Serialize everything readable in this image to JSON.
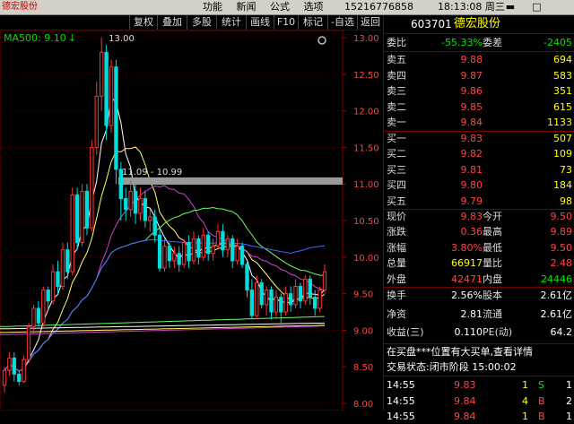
{
  "app": {
    "title": "德宏股份",
    "menu": [
      "功能",
      "新闻",
      "公式",
      "选项"
    ],
    "phone": "15216776858",
    "clock": "18:13:08 周三",
    "window_buttons": [
      "▬",
      "□",
      "✕"
    ]
  },
  "toolbar": [
    "复权",
    "叠加",
    "多股",
    "统计",
    "画线",
    "F10",
    "标记",
    "-自选",
    "返回"
  ],
  "chart_data": {
    "type": "candlestick",
    "indicator_label": "MA500: 9.10",
    "indicator_arrow": "↓",
    "y_ticks": [
      "13.00",
      "12.50",
      "12.00",
      "11.50",
      "11.00",
      "10.50",
      "10.00",
      "9.50",
      "9.00",
      "8.50",
      "8.00"
    ],
    "ylim": [
      8.0,
      13.05
    ],
    "high_label": "13.00",
    "band_label": "11.09 - 10.99",
    "band": [
      10.99,
      11.09
    ],
    "candles": [
      [
        8.25,
        8.45,
        8.15,
        8.5
      ],
      [
        8.45,
        8.62,
        8.38,
        8.7
      ],
      [
        8.62,
        8.4,
        8.3,
        8.7
      ],
      [
        8.4,
        8.3,
        8.25,
        8.45
      ],
      [
        8.3,
        8.6,
        8.28,
        8.65
      ],
      [
        8.6,
        9.05,
        8.55,
        9.1
      ],
      [
        9.05,
        9.3,
        8.95,
        9.35
      ],
      [
        9.3,
        9.1,
        9.05,
        9.4
      ],
      [
        9.1,
        9.55,
        9.05,
        9.6
      ],
      [
        9.55,
        9.4,
        9.3,
        9.6
      ],
      [
        9.4,
        9.8,
        9.35,
        9.9
      ],
      [
        9.8,
        9.6,
        9.5,
        9.95
      ],
      [
        9.6,
        10.1,
        9.55,
        10.2
      ],
      [
        10.1,
        9.8,
        9.7,
        10.2
      ],
      [
        9.8,
        10.85,
        9.75,
        10.95
      ],
      [
        10.85,
        10.2,
        10.1,
        10.95
      ],
      [
        10.2,
        10.9,
        10.15,
        11.0
      ],
      [
        10.9,
        10.4,
        10.3,
        11.0
      ],
      [
        10.4,
        11.5,
        10.35,
        11.6
      ],
      [
        11.5,
        12.2,
        11.4,
        12.4
      ],
      [
        12.2,
        12.8,
        12.0,
        13.0
      ],
      [
        12.8,
        11.8,
        11.6,
        12.9
      ],
      [
        11.8,
        12.6,
        11.7,
        12.7
      ],
      [
        12.6,
        11.2,
        11.0,
        12.7
      ],
      [
        11.2,
        10.8,
        10.5,
        11.3
      ],
      [
        10.8,
        10.65,
        10.5,
        10.95
      ],
      [
        10.65,
        10.9,
        10.55,
        11.05
      ],
      [
        10.9,
        10.6,
        10.45,
        11.0
      ],
      [
        10.6,
        10.8,
        10.5,
        10.95
      ],
      [
        10.8,
        10.5,
        10.4,
        10.9
      ],
      [
        10.5,
        10.55,
        10.35,
        10.65
      ],
      [
        10.55,
        10.3,
        10.2,
        10.65
      ],
      [
        10.3,
        9.85,
        9.8,
        10.4
      ],
      [
        9.85,
        10.15,
        9.8,
        10.25
      ],
      [
        10.15,
        9.95,
        9.85,
        10.2
      ],
      [
        9.95,
        10.05,
        9.85,
        10.15
      ],
      [
        10.05,
        9.9,
        9.8,
        10.15
      ],
      [
        9.9,
        10.2,
        9.85,
        10.25
      ],
      [
        10.2,
        9.95,
        9.85,
        10.3
      ],
      [
        9.95,
        10.25,
        9.9,
        10.35
      ],
      [
        10.25,
        10.0,
        9.9,
        10.3
      ],
      [
        10.0,
        10.3,
        9.95,
        10.4
      ],
      [
        10.3,
        10.05,
        9.95,
        10.35
      ],
      [
        10.05,
        10.15,
        9.95,
        10.25
      ],
      [
        10.15,
        10.35,
        10.1,
        10.45
      ],
      [
        10.35,
        10.1,
        10.0,
        10.45
      ],
      [
        10.1,
        10.25,
        10.0,
        10.3
      ],
      [
        10.25,
        9.95,
        9.85,
        10.3
      ],
      [
        9.95,
        10.15,
        9.9,
        10.25
      ],
      [
        10.15,
        9.9,
        9.85,
        10.2
      ],
      [
        9.9,
        9.55,
        9.45,
        9.95
      ],
      [
        9.55,
        9.2,
        9.15,
        9.7
      ],
      [
        9.2,
        9.65,
        9.15,
        9.75
      ],
      [
        9.65,
        9.35,
        9.3,
        9.7
      ],
      [
        9.35,
        9.55,
        9.2,
        9.6
      ],
      [
        9.55,
        9.25,
        9.15,
        9.6
      ],
      [
        9.25,
        9.45,
        9.15,
        9.55
      ],
      [
        9.45,
        9.25,
        9.1,
        9.5
      ],
      [
        9.25,
        9.5,
        9.2,
        9.6
      ],
      [
        9.5,
        9.35,
        9.25,
        9.6
      ],
      [
        9.35,
        9.6,
        9.3,
        9.7
      ],
      [
        9.6,
        9.4,
        9.3,
        9.65
      ],
      [
        9.4,
        9.7,
        9.35,
        9.75
      ],
      [
        9.7,
        9.45,
        9.35,
        9.75
      ],
      [
        9.45,
        9.3,
        9.2,
        9.55
      ],
      [
        9.3,
        9.55,
        9.25,
        9.6
      ],
      [
        9.55,
        9.8,
        9.5,
        9.9
      ]
    ]
  },
  "quote": {
    "code": "603701",
    "name": "德宏股份",
    "weibi_label": "委比",
    "weibi": "-55.33%",
    "weicha_label": "委差",
    "weicha": "-2405",
    "sells": [
      {
        "label": "卖五",
        "price": "9.88",
        "vol": "694"
      },
      {
        "label": "卖四",
        "price": "9.87",
        "vol": "583"
      },
      {
        "label": "卖三",
        "price": "9.86",
        "vol": "351"
      },
      {
        "label": "卖二",
        "price": "9.85",
        "vol": "615"
      },
      {
        "label": "卖一",
        "price": "9.84",
        "vol": "1133"
      }
    ],
    "buys": [
      {
        "label": "买一",
        "price": "9.83",
        "vol": "507"
      },
      {
        "label": "买二",
        "price": "9.82",
        "vol": "109"
      },
      {
        "label": "买三",
        "price": "9.81",
        "vol": "73"
      },
      {
        "label": "买四",
        "price": "9.80",
        "vol": "184"
      },
      {
        "label": "买五",
        "price": "9.79",
        "vol": "98"
      }
    ],
    "stats": [
      {
        "l1": "现价",
        "v1": "9.83",
        "c1": "red",
        "l2": "今开",
        "v2": "9.50",
        "c2": "red"
      },
      {
        "l1": "涨跌",
        "v1": "0.36",
        "c1": "red",
        "l2": "最高",
        "v2": "9.89",
        "c2": "red"
      },
      {
        "l1": "涨幅",
        "v1": "3.80%",
        "c1": "red",
        "l2": "最低",
        "v2": "9.50",
        "c2": "red"
      },
      {
        "l1": "总量",
        "v1": "66917",
        "c1": "yellow",
        "l2": "量比",
        "v2": "2.48",
        "c2": "red"
      },
      {
        "l1": "外盘",
        "v1": "42471",
        "c1": "red",
        "l2": "内盘",
        "v2": "24446",
        "c2": "green"
      }
    ],
    "stats2": [
      {
        "l1": "换手",
        "v1": "2.56%",
        "l2": "股本",
        "v2": "2.61亿"
      },
      {
        "l1": "净资",
        "v1": "2.81",
        "l2": "流通",
        "v2": "2.61亿"
      },
      {
        "l1": "收益(三)",
        "v1": "0.110",
        "l2": "PE(动)",
        "v2": "64.2"
      }
    ],
    "notice": "在买盘***位置有大买单,查看详情",
    "status": "交易状态:闭市阶段 15:00:02",
    "ticks": [
      {
        "time": "14:55",
        "price": "9.83",
        "price_color": "red",
        "vol": "1",
        "dir": "S",
        "dir_color": "green",
        "trades": "1"
      },
      {
        "time": "14:55",
        "price": "9.84",
        "price_color": "red",
        "vol": "4",
        "dir": "B",
        "dir_color": "red",
        "trades": "2"
      },
      {
        "time": "14:55",
        "price": "9.84",
        "price_color": "red",
        "vol": "1",
        "dir": "B",
        "dir_color": "red",
        "trades": "1"
      }
    ]
  },
  "colors": {
    "up": "#ff3333",
    "down": "#00dddd",
    "grid": "#550000",
    "bg": "#000000"
  }
}
